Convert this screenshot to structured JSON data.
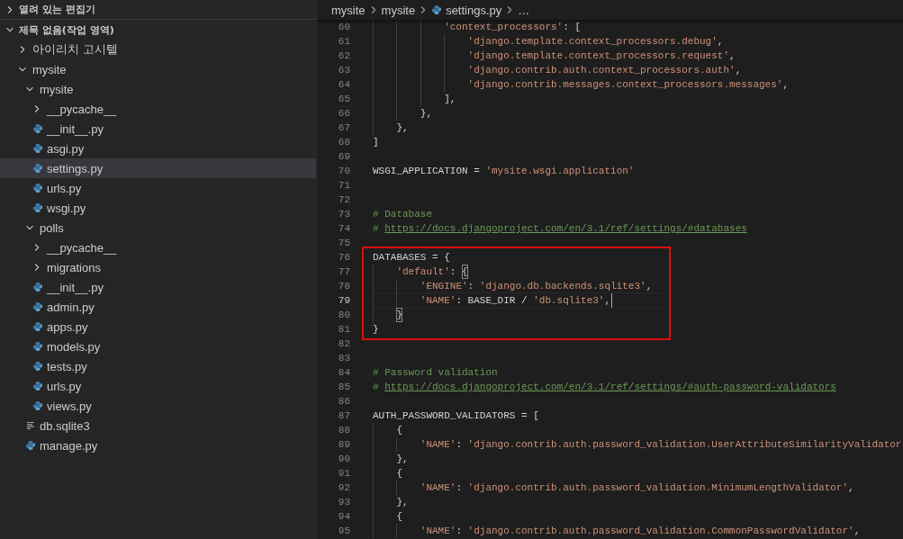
{
  "sidebar": {
    "sections": [
      {
        "title": "열려 있는 편집기",
        "expanded": false
      },
      {
        "title": "제목 없음(작업 영역)",
        "expanded": true
      }
    ],
    "tree": [
      {
        "label": "아이리치 고시텔",
        "kind": "folder",
        "expanded": false,
        "selected": false
      },
      {
        "label": "mysite",
        "kind": "folder",
        "expanded": true,
        "selected": false,
        "children": [
          {
            "label": "mysite",
            "kind": "folder",
            "expanded": true,
            "selected": false,
            "children": [
              {
                "label": "__pycache__",
                "kind": "folder",
                "expanded": false,
                "selected": false
              },
              {
                "label": "__init__.py",
                "kind": "python",
                "selected": false
              },
              {
                "label": "asgi.py",
                "kind": "python",
                "selected": false
              },
              {
                "label": "settings.py",
                "kind": "python",
                "selected": true
              },
              {
                "label": "urls.py",
                "kind": "python",
                "selected": false
              },
              {
                "label": "wsgi.py",
                "kind": "python",
                "selected": false
              }
            ]
          },
          {
            "label": "polls",
            "kind": "folder",
            "expanded": true,
            "selected": false,
            "children": [
              {
                "label": "__pycache__",
                "kind": "folder",
                "expanded": false,
                "selected": false
              },
              {
                "label": "migrations",
                "kind": "folder",
                "expanded": false,
                "selected": false
              },
              {
                "label": "__init__.py",
                "kind": "python",
                "selected": false
              },
              {
                "label": "admin.py",
                "kind": "python",
                "selected": false
              },
              {
                "label": "apps.py",
                "kind": "python",
                "selected": false
              },
              {
                "label": "models.py",
                "kind": "python",
                "selected": false
              },
              {
                "label": "tests.py",
                "kind": "python",
                "selected": false
              },
              {
                "label": "urls.py",
                "kind": "python",
                "selected": false
              },
              {
                "label": "views.py",
                "kind": "python",
                "selected": false
              }
            ]
          },
          {
            "label": "db.sqlite3",
            "kind": "text",
            "selected": false
          },
          {
            "label": "manage.py",
            "kind": "python",
            "selected": false
          }
        ]
      }
    ]
  },
  "breadcrumb": [
    {
      "label": "mysite",
      "kind": "folder"
    },
    {
      "label": "mysite",
      "kind": "folder"
    },
    {
      "label": "settings.py",
      "kind": "python"
    },
    {
      "label": "…",
      "kind": "more"
    }
  ],
  "editor": {
    "blocks": [
      {
        "boxed": false,
        "lines": [
          {
            "number": "60",
            "current": false,
            "tokens": [
              {
                "kind": "string",
                "text": "            'context_processors'"
              },
              {
                "kind": "plain",
                "text": ": ["
              }
            ]
          },
          {
            "number": "61",
            "current": false,
            "tokens": [
              {
                "kind": "string",
                "text": "                'django.template.context_processors.debug'"
              },
              {
                "kind": "plain",
                "text": ","
              }
            ]
          },
          {
            "number": "62",
            "current": false,
            "tokens": [
              {
                "kind": "string",
                "text": "                'django.template.context_processors.request'"
              },
              {
                "kind": "plain",
                "text": ","
              }
            ]
          },
          {
            "number": "63",
            "current": false,
            "tokens": [
              {
                "kind": "string",
                "text": "                'django.contrib.auth.context_processors.auth'"
              },
              {
                "kind": "plain",
                "text": ","
              }
            ]
          },
          {
            "number": "64",
            "current": false,
            "tokens": [
              {
                "kind": "string",
                "text": "                'django.contrib.messages.context_processors.messages'"
              },
              {
                "kind": "plain",
                "text": ","
              }
            ]
          },
          {
            "number": "65",
            "current": false,
            "tokens": [
              {
                "kind": "plain",
                "text": "            ],"
              }
            ]
          },
          {
            "number": "66",
            "current": false,
            "tokens": [
              {
                "kind": "plain",
                "text": "        },"
              }
            ]
          },
          {
            "number": "67",
            "current": false,
            "tokens": [
              {
                "kind": "plain",
                "text": "    },"
              }
            ]
          },
          {
            "number": "68",
            "current": false,
            "tokens": [
              {
                "kind": "plain",
                "text": "]"
              }
            ]
          },
          {
            "number": "69",
            "current": false
          },
          {
            "number": "70",
            "current": false,
            "tokens": [
              {
                "kind": "plain",
                "text": "WSGI_APPLICATION = "
              },
              {
                "kind": "string",
                "text": "'mysite.wsgi.application'"
              }
            ]
          },
          {
            "number": "71",
            "current": false
          },
          {
            "number": "72",
            "current": false
          },
          {
            "number": "73",
            "current": false,
            "tokens": [
              {
                "kind": "comment",
                "text": "# Database"
              }
            ]
          },
          {
            "number": "74",
            "current": false,
            "tokens": [
              {
                "kind": "comment",
                "text": "# "
              },
              {
                "kind": "link",
                "text": "https://docs.djangoproject.com/en/3.1/ref/settings/#databases"
              }
            ]
          },
          {
            "number": "75",
            "current": false
          }
        ]
      },
      {
        "boxed": true,
        "lines": [
          {
            "number": "76",
            "current": false,
            "tokens": [
              {
                "kind": "plain",
                "text": "DATABASES = {"
              }
            ]
          },
          {
            "number": "77",
            "current": false,
            "tokens": [
              {
                "kind": "string",
                "text": "    'default'"
              },
              {
                "kind": "plain",
                "text": ": "
              },
              {
                "kind": "bracket-match",
                "text": "{"
              }
            ]
          },
          {
            "number": "78",
            "current": false,
            "tokens": [
              {
                "kind": "string",
                "text": "        'ENGINE'"
              },
              {
                "kind": "plain",
                "text": ": "
              },
              {
                "kind": "string",
                "text": "'django.db.backends.sqlite3'"
              },
              {
                "kind": "plain",
                "text": ","
              }
            ]
          },
          {
            "number": "79",
            "current": true,
            "tokens": [
              {
                "kind": "string",
                "text": "        'NAME'"
              },
              {
                "kind": "plain",
                "text": ": BASE_DIR / "
              },
              {
                "kind": "string",
                "text": "'db.sqlite3'"
              },
              {
                "kind": "plain",
                "text": ","
              }
            ]
          },
          {
            "number": "80",
            "current": false,
            "tokens": [
              {
                "kind": "bracket-match",
                "text": "    }"
              }
            ]
          },
          {
            "number": "81",
            "current": false,
            "tokens": [
              {
                "kind": "plain",
                "text": "}"
              }
            ]
          }
        ]
      },
      {
        "boxed": false,
        "lines": [
          {
            "number": "82",
            "current": false
          },
          {
            "number": "83",
            "current": false
          },
          {
            "number": "84",
            "current": false,
            "tokens": [
              {
                "kind": "comment",
                "text": "# Password validation"
              }
            ]
          },
          {
            "number": "85",
            "current": false,
            "tokens": [
              {
                "kind": "comment",
                "text": "# "
              },
              {
                "kind": "link",
                "text": "https://docs.djangoproject.com/en/3.1/ref/settings/#auth-password-validators"
              }
            ]
          },
          {
            "number": "86",
            "current": false
          },
          {
            "number": "87",
            "current": false,
            "tokens": [
              {
                "kind": "plain",
                "text": "AUTH_PASSWORD_VALIDATORS = ["
              }
            ]
          },
          {
            "number": "88",
            "current": false,
            "tokens": [
              {
                "kind": "plain",
                "text": "    {"
              }
            ]
          },
          {
            "number": "89",
            "current": false,
            "tokens": [
              {
                "kind": "string",
                "text": "        'NAME'"
              },
              {
                "kind": "plain",
                "text": ": "
              },
              {
                "kind": "string",
                "text": "'django.contrib.auth.password_validation.UserAttributeSimilarityValidator"
              }
            ]
          },
          {
            "number": "90",
            "current": false,
            "tokens": [
              {
                "kind": "plain",
                "text": "    },"
              }
            ]
          },
          {
            "number": "91",
            "current": false,
            "tokens": [
              {
                "kind": "plain",
                "text": "    {"
              }
            ]
          },
          {
            "number": "92",
            "current": false,
            "tokens": [
              {
                "kind": "string",
                "text": "        'NAME'"
              },
              {
                "kind": "plain",
                "text": ": "
              },
              {
                "kind": "string",
                "text": "'django.contrib.auth.password_validation.MinimumLengthValidator'"
              },
              {
                "kind": "plain",
                "text": ","
              }
            ]
          },
          {
            "number": "93",
            "current": false,
            "tokens": [
              {
                "kind": "plain",
                "text": "    },"
              }
            ]
          },
          {
            "number": "94",
            "current": false,
            "tokens": [
              {
                "kind": "plain",
                "text": "    {"
              }
            ]
          },
          {
            "number": "95",
            "current": false,
            "tokens": [
              {
                "kind": "string",
                "text": "        'NAME'"
              },
              {
                "kind": "plain",
                "text": ": "
              },
              {
                "kind": "string",
                "text": "'django.contrib.auth.password_validation.CommonPasswordValidator'"
              },
              {
                "kind": "plain",
                "text": ","
              }
            ]
          }
        ]
      }
    ]
  }
}
